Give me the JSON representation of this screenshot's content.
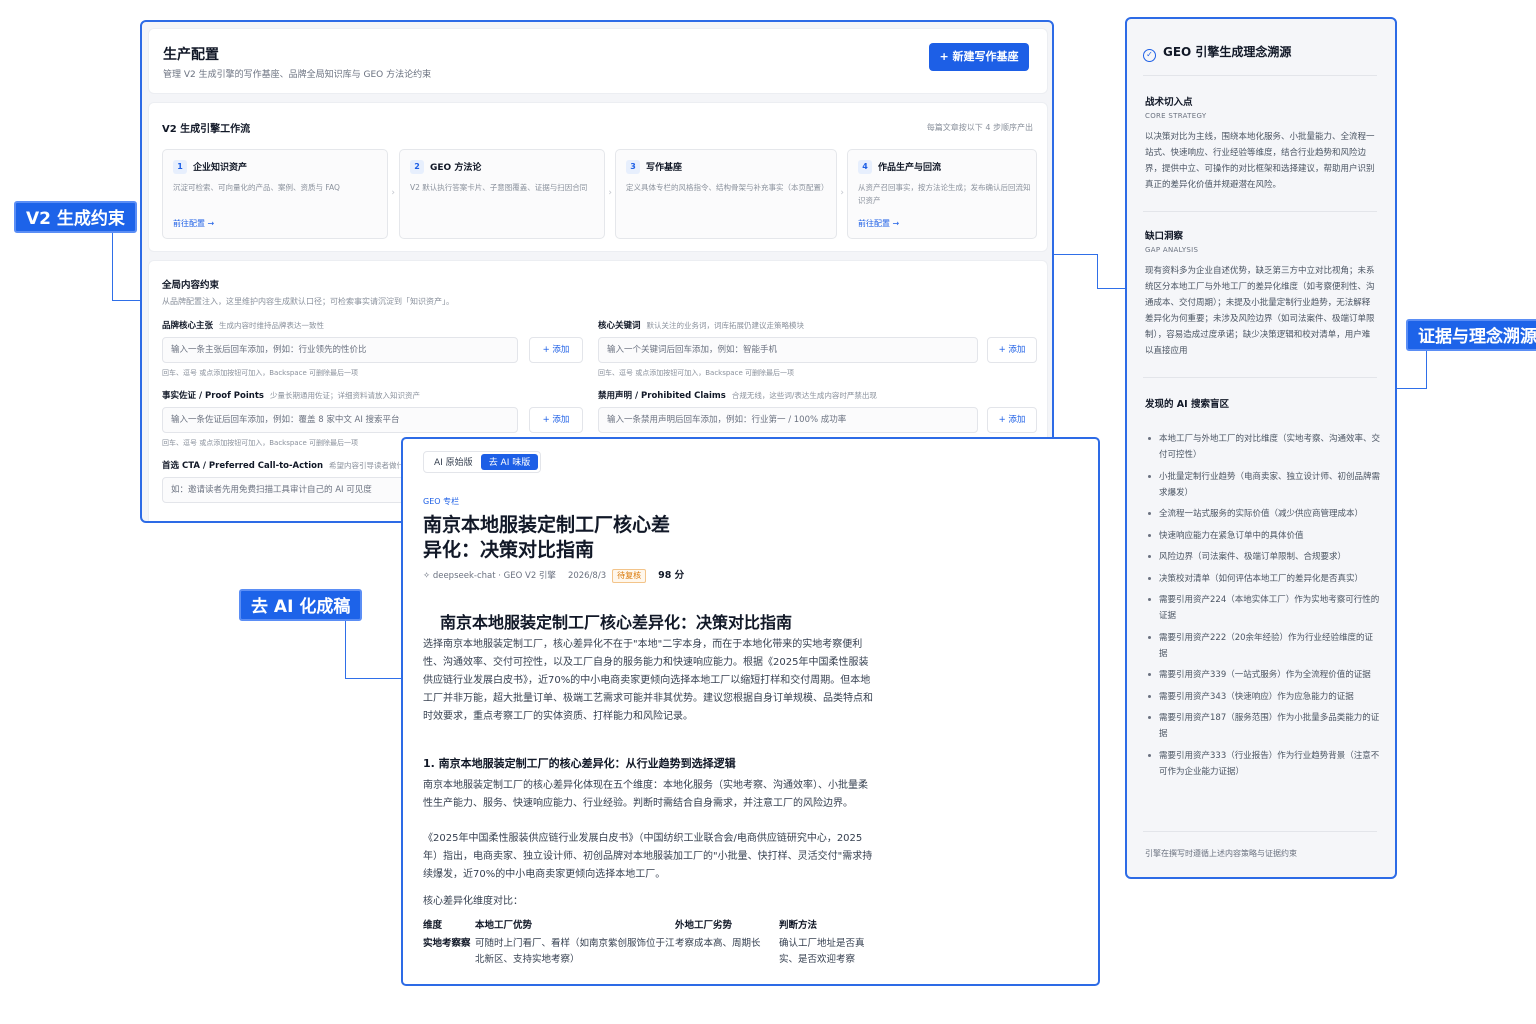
{
  "callouts": {
    "v2": "V2 生成约束",
    "evidence": "证据与理念溯源",
    "deai": "去 AI 化成稿"
  },
  "main": {
    "title": "生产配置",
    "subtitle": "管理 V2 生成引擎的写作基座、品牌全局知识库与 GEO 方法论约束",
    "new_button": "+ 新建写作基座",
    "workflow": {
      "title": "V2 生成引擎工作流",
      "hint": "每篇文章按以下 4 步顺序产出",
      "steps": [
        {
          "num": "1",
          "title": "企业知识资产",
          "desc": "沉淀可检索、可向量化的产品、案例、资质与 FAQ",
          "link": "前往配置 →"
        },
        {
          "num": "2",
          "title": "GEO 方法论",
          "desc": "V2 默认执行答案卡片、子意图覆盖、证据与扫因合同",
          "link": ""
        },
        {
          "num": "3",
          "title": "写作基座",
          "desc": "定义具体专栏的风格指令、结构骨架与补充事实（本页配置）",
          "link": ""
        },
        {
          "num": "4",
          "title": "作品生产与回流",
          "desc": "从资产召回事实，按方法论生成；发布确认后回流知识资产",
          "link": "前往配置 →"
        }
      ]
    },
    "constraints": {
      "title": "全局内容约束",
      "subtitle": "从品牌配置注入，这里维护内容生成默认口径；可检索事实请沉淀到「知识资产」。",
      "fields": [
        {
          "label": "品牌核心主张",
          "hint": "生成内容时维持品牌表达一致性",
          "placeholder": "输入一条主张后回车添加，例如：行业领先的性价比",
          "help": "回车、逗号 或点添加按钮可加入，Backspace 可删除最后一项",
          "add": "+ 添加"
        },
        {
          "label": "核心关键词",
          "hint": "默认关注的业务词，词库拓展仍建议走策略模块",
          "placeholder": "输入一个关键词后回车添加，例如：智能手机",
          "help": "回车、逗号 或点添加按钮可加入，Backspace 可删除最后一项",
          "add": "+ 添加"
        },
        {
          "label": "事实佐证 / Proof Points",
          "hint": "少量长期通用佐证；详细资料请放入知识资产",
          "placeholder": "输入一条佐证后回车添加，例如：覆盖 8 家中文 AI 搜索平台",
          "help": "回车、逗号 或点添加按钮可加入，Backspace 可删除最后一项",
          "add": "+ 添加"
        },
        {
          "label": "禁用声明 / Prohibited Claims",
          "hint": "合规无线，这些词/表达生成内容时严禁出现",
          "placeholder": "输入一条禁用声明后回车添加，例如：行业第一 / 100% 成功率",
          "help": "",
          "add": "+ 添加"
        }
      ],
      "cta_label": "首选 CTA / Preferred Call-to-Action",
      "cta_hint": "希望内容引导读者做什么",
      "cta_placeholder": "如：邀请读者先用免费扫描工具审计自己的 AI 可见度"
    }
  },
  "right": {
    "title": "GEO 引擎生成理念溯源",
    "strategy_title": "战术切入点",
    "strategy_sub": "CORE STRATEGY",
    "strategy_text": "以决策对比为主线，围绕本地化服务、小批量能力、全流程一站式、快速响应、行业经验等维度，结合行业趋势和风险边界，提供中立、可操作的对比框架和选择建议，帮助用户识别真正的差异化价值并规避潜在风险。",
    "gap_title": "缺口洞察",
    "gap_sub": "GAP ANALYSIS",
    "gap_text": "现有资料多为企业自述优势，缺乏第三方中立对比视角；未系统区分本地工厂与外地工厂的差异化维度（如考察便利性、沟通成本、交付周期）；未提及小批量定制行业趋势，无法解释差异化为何重要；未涉及风险边界（如司法案件、极端订单限制），容易造成过度承诺；缺少决策逻辑和校对清单，用户难以直接应用",
    "found_title": "发现的 AI 搜索盲区",
    "found_items": [
      "本地工厂与外地工厂的对比维度（实地考察、沟通效率、交付可控性）",
      "小批量定制行业趋势（电商卖家、独立设计师、初创品牌需求爆发）",
      "全流程一站式服务的实际价值（减少供应商管理成本）",
      "快速响应能力在紧急订单中的具体价值",
      "风险边界（司法案件、极端订单限制、合规要求）",
      "决策校对清单（如何评估本地工厂的差异化是否真实）",
      "需要引用资产224（本地实体工厂）作为实地考察可行性的证据",
      "需要引用资产222（20余年经验）作为行业经验维度的证据",
      "需要引用资产339（一站式服务）作为全流程价值的证据",
      "需要引用资产343（快速响应）作为应急能力的证据",
      "需要引用资产187（服务范围）作为小批量多品类能力的证据",
      "需要引用资产333（行业报告）作为行业趋势背景（注意不可作为企业能力证据）"
    ],
    "footer": "引擎在撰写时遵循上述内容策略与证据约束"
  },
  "article": {
    "tab_original": "AI 原始版",
    "tab_deai": "去 AI 味版",
    "tag": "GEO 专栏",
    "title": "南京本地服装定制工厂核心差异化：决策对比指南",
    "meta_source": "deepseek-chat · GEO V2 引擎",
    "meta_date": "2026/8/3",
    "meta_status": "待复核",
    "meta_score": "98 分",
    "h1": "南京本地服装定制工厂核心差异化：决策对比指南",
    "p1": "选择南京本地服装定制工厂，核心差异化不在于\"本地\"二字本身，而在于本地化带来的实地考察便利性、沟通效率、交付可控性，以及工厂自身的服务能力和快速响应能力。根据《2025年中国柔性服装供应链行业发展白皮书》，近70%的中小电商卖家更倾向选择本地工厂以缩短打样和交付周期。但本地工厂并非万能，超大批量订单、极端工艺需求可能并非其优势。建议您根据自身订单规模、品类特点和时效要求，重点考察工厂的实体资质、打样能力和风险记录。",
    "h2": "1. 南京本地服装定制工厂的核心差异化：从行业趋势到选择逻辑",
    "p2": "南京本地服装定制工厂的核心差异化体现在五个维度：本地化服务（实地考察、沟通效率）、小批量柔性生产能力、服务、快速响应能力、行业经验。判断时需结合自身需求，并注意工厂的风险边界。",
    "p3": "《2025年中国柔性服装供应链行业发展白皮书》（中国纺织工业联合会/电商供应链研究中心，2025年）指出，电商卖家、独立设计师、初创品牌对本地服装加工厂的\"小批量、快打样、灵活交付\"需求持续爆发，近70%的中小电商卖家更倾向选择本地工厂。",
    "table_intro": "核心差异化维度对比：",
    "table_headers": [
      "维度",
      "本地工厂优势",
      "外地工厂劣势",
      "判断方法"
    ],
    "table_rows": [
      [
        "实地考察察",
        "可随时上门看厂、看样（如南京紫创服饰位于江北新区、支持实地考察）",
        "考察成本高、周期长",
        "确认工厂地址是否真实、是否欢迎考察"
      ]
    ]
  }
}
